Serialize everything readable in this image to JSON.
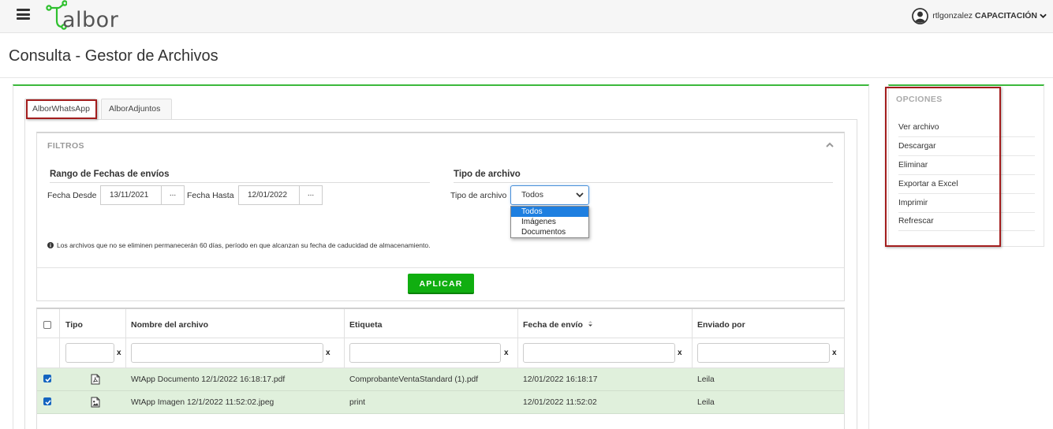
{
  "header": {
    "logo_text": "albor",
    "user_name": "rtlgonzalez",
    "company": "CAPACITACIÓN"
  },
  "page": {
    "title": "Consulta - Gestor de Archivos"
  },
  "tabs": [
    {
      "label": "AlborWhatsApp",
      "active": true
    },
    {
      "label": "AlborAdjuntos",
      "active": false
    }
  ],
  "filtros": {
    "title": "FILTROS",
    "rango": {
      "title": "Rango de Fechas de envíos",
      "desde_label": "Fecha Desde",
      "desde_value": "13/11/2021",
      "hasta_label": "Fecha Hasta",
      "hasta_value": "12/01/2022",
      "picker_label": "..."
    },
    "tipo": {
      "title": "Tipo de archivo",
      "label": "Tipo de archivo",
      "selected": "Todos",
      "options": [
        "Todos",
        "Imágenes",
        "Documentos"
      ]
    },
    "note": "Los archivos que no se eliminen permanecerán 60 días, período en que alcanzan su fecha de caducidad de almacenamiento.",
    "apply_label": "APLICAR"
  },
  "table": {
    "headers": {
      "tipo": "Tipo",
      "nombre": "Nombre del archivo",
      "etiqueta": "Etiqueta",
      "fecha": "Fecha de envío",
      "enviado": "Enviado por"
    },
    "clear_label": "x",
    "rows": [
      {
        "checked": true,
        "icon": "pdf-file-icon",
        "nombre": "WtApp Documento 12/1/2022 16:18:17.pdf",
        "etiqueta": "ComprobanteVentaStandard (1).pdf",
        "fecha": "12/01/2022 16:18:17",
        "enviado": "Leila"
      },
      {
        "checked": true,
        "icon": "image-file-icon",
        "nombre": "WtApp Imagen 12/1/2022 11:52:02.jpeg",
        "etiqueta": "print",
        "fecha": "12/01/2022 11:52:02",
        "enviado": "Leila"
      }
    ]
  },
  "opciones": {
    "title": "OPCIONES",
    "items": [
      "Ver archivo",
      "Descargar",
      "Eliminar",
      "Exportar a Excel",
      "Imprimir",
      "Refrescar"
    ]
  },
  "colors": {
    "accent_green": "#3cb83c",
    "button_green": "#10ae10",
    "highlight_red": "#a31d1d",
    "row_selected": "#e0f0dc",
    "dropdown_selected": "#1e7fe0"
  }
}
